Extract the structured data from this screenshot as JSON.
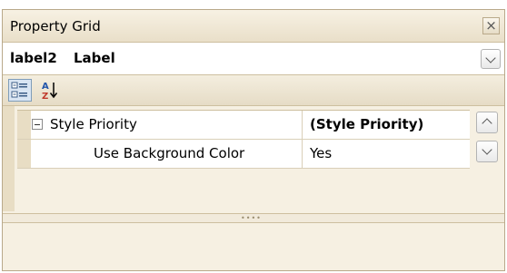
{
  "window": {
    "title": "Property Grid",
    "close_icon": "close-icon"
  },
  "selector": {
    "object_name": "label2",
    "object_type": "Label",
    "dropdown_icon": "chevron-down-icon"
  },
  "toolbar": {
    "categorized_icon": "categorized-view-icon",
    "alphabetical_icon": "sort-alphabetical-icon",
    "active_view": "categorized"
  },
  "grid": {
    "rows": [
      {
        "name": "Style Priority",
        "value": "(Style Priority)",
        "expanded": true,
        "bold_value": true
      },
      {
        "name": "Use Background Color",
        "value": "Yes"
      }
    ]
  },
  "colors": {
    "panel_bg": "#f6f0e2",
    "border": "#b9a98a",
    "active_button": "#d9e5f3"
  }
}
